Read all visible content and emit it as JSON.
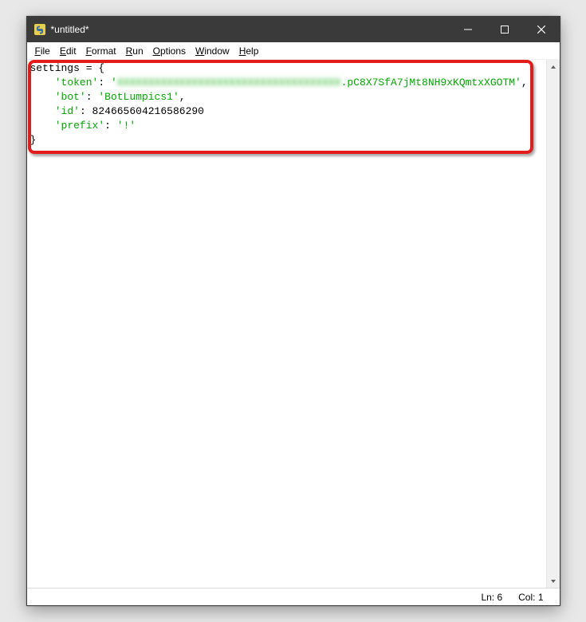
{
  "window": {
    "title": "*untitled*",
    "icon_name": "python-idle-icon"
  },
  "menubar": {
    "items": [
      "File",
      "Edit",
      "Format",
      "Run",
      "Options",
      "Window",
      "Help"
    ]
  },
  "code": {
    "line1_a": "settings = {",
    "line2_key": "'token'",
    "line2_colon": ": ",
    "line2_open": "'",
    "line2_blurred": "XXXXXXXXXXXXXXXXXXXXXXXXXXXXXXXXXXXX",
    "line2_visible": ".pC8X7SfA7jMt8NH9xKQmtxXGOTM'",
    "line2_end": ",",
    "line3_key": "'bot'",
    "line3_colon": ": ",
    "line3_val": "'BotLumpics1'",
    "line3_end": ",",
    "line4_key": "'id'",
    "line4_colon": ": ",
    "line4_val": "824665604216586290",
    "line5_key": "'prefix'",
    "line5_colon": ": ",
    "line5_val": "'!'",
    "line6": "}"
  },
  "statusbar": {
    "line": "Ln: 6",
    "col": "Col: 1"
  }
}
